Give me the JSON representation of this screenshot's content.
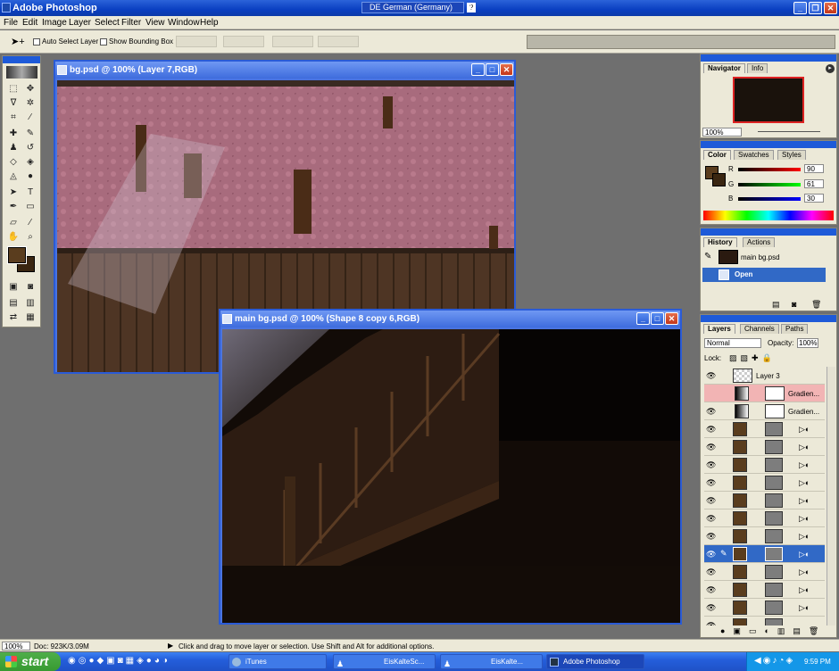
{
  "app": {
    "title": "Adobe Photoshop",
    "language": "DE German (Germany)",
    "help_glyph": "?"
  },
  "menu": [
    "File",
    "Edit",
    "Image",
    "Layer",
    "Select",
    "Filter",
    "View",
    "Window",
    "Help"
  ],
  "options": {
    "auto_select": "Auto Select Layer",
    "bounding_box": "Show Bounding Box"
  },
  "windows": {
    "bg": {
      "title": "bg.psd @ 100% (Layer 7,RGB)"
    },
    "main": {
      "title": "main bg.psd @ 100% (Shape 8 copy 6,RGB)"
    }
  },
  "navigator": {
    "tabs": [
      "Navigator",
      "Info"
    ],
    "zoom": "100%"
  },
  "color": {
    "tabs": [
      "Color",
      "Swatches",
      "Styles"
    ],
    "r": "90",
    "g": "61",
    "b": "30",
    "r_label": "R",
    "g_label": "G",
    "b_label": "B",
    "fg": "#5a3d1e"
  },
  "history": {
    "tabs": [
      "History",
      "Actions"
    ],
    "snapshot": "main bg.psd",
    "step": "Open"
  },
  "layers": {
    "tabs": [
      "Layers",
      "Channels",
      "Paths"
    ],
    "blend": "Normal",
    "opacity_label": "Opacity:",
    "opacity": "100%",
    "lock_label": "Lock:",
    "rows": [
      {
        "name": "Layer 3"
      },
      {
        "name": "Gradien..."
      },
      {
        "name": "Gradien..."
      },
      {
        "name": ""
      },
      {
        "name": ""
      },
      {
        "name": ""
      },
      {
        "name": ""
      },
      {
        "name": ""
      },
      {
        "name": ""
      },
      {
        "name": ""
      },
      {
        "name": ""
      },
      {
        "name": ""
      },
      {
        "name": ""
      },
      {
        "name": ""
      },
      {
        "name": ""
      }
    ]
  },
  "status": {
    "zoom": "100%",
    "doc": "Doc: 923K/3.09M",
    "hint": "Click and drag to move layer or selection. Use Shift and Alt for additional options."
  },
  "taskbar": {
    "start": "start",
    "tasks": [
      {
        "label": "iTunes"
      },
      {
        "label": "EisKalteSc..."
      },
      {
        "label": "EisKalte..."
      },
      {
        "label": "Adobe Photoshop"
      }
    ],
    "clock": "9:59 PM"
  }
}
